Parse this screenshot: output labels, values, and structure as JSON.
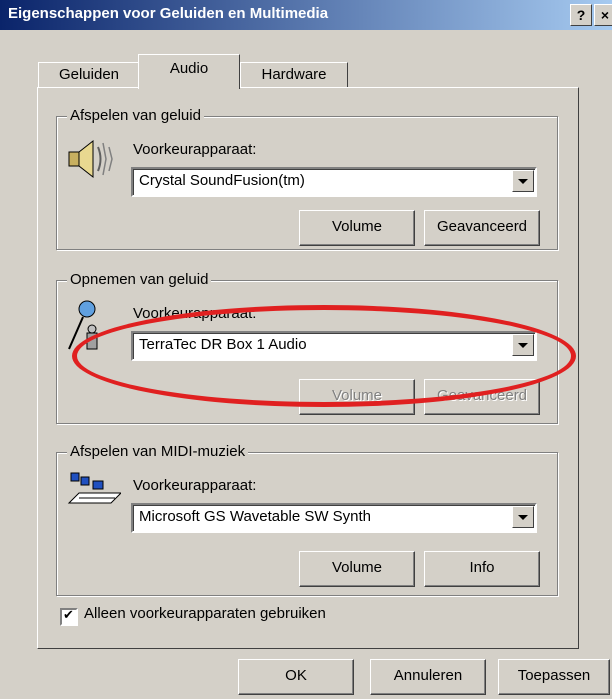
{
  "window": {
    "title": "Eigenschappen voor Geluiden en Multimedia",
    "help_label": "?",
    "close_label": "×"
  },
  "tabs": [
    {
      "label": "Geluiden"
    },
    {
      "label": "Audio"
    },
    {
      "label": "Hardware"
    }
  ],
  "playback": {
    "legend": "Afspelen van geluid",
    "device_label": "Voorkeurapparaat:",
    "device_value": "Crystal SoundFusion(tm)",
    "volume_label": "Volume",
    "advanced_label": "Geavanceerd"
  },
  "recording": {
    "legend": "Opnemen van geluid",
    "device_label": "Voorkeurapparaat:",
    "device_value": "TerraTec DR Box 1 Audio",
    "volume_label": "Volume",
    "advanced_label": "Geavanceerd"
  },
  "midi": {
    "legend": "Afspelen van MIDI-muziek",
    "device_label": "Voorkeurapparaat:",
    "device_value": "Microsoft GS Wavetable SW Synth",
    "volume_label": "Volume",
    "info_label": "Info"
  },
  "only_preferred": {
    "label": "Alleen voorkeurapparaten gebruiken",
    "checked": true
  },
  "footer": {
    "ok_label": "OK",
    "cancel_label": "Annuleren",
    "apply_label": "Toepassen"
  },
  "colors": {
    "titlebar": "#0a246a",
    "face": "#d4d0c8",
    "highlight": "#e02020"
  }
}
